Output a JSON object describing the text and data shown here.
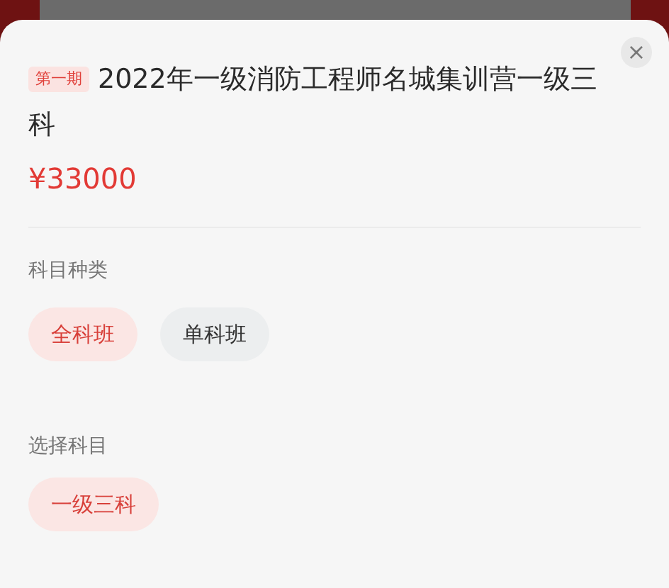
{
  "product": {
    "badge": "第一期",
    "title": "2022年一级消防工程师名城集训营一级三科",
    "price": "¥33000"
  },
  "close": "×",
  "sections": [
    {
      "label": "科目种类",
      "options": [
        {
          "label": "全科班",
          "selected": true
        },
        {
          "label": "单科班",
          "selected": false
        }
      ]
    },
    {
      "label": "选择科目",
      "options": [
        {
          "label": "一级三科",
          "selected": true
        }
      ]
    }
  ]
}
